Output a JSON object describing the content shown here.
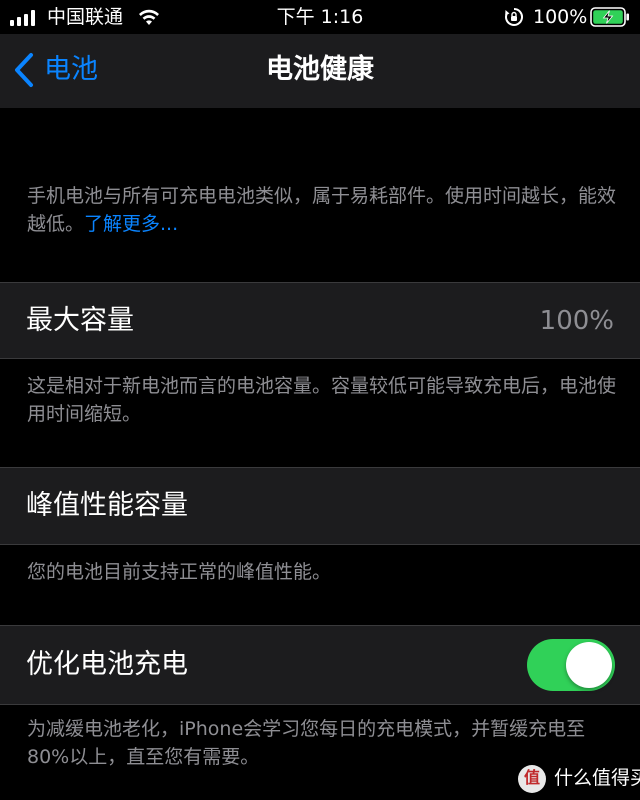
{
  "status_bar": {
    "carrier": "中国联通",
    "time": "下午 1:16",
    "battery_percent": "100%",
    "icons": [
      "signal-icon",
      "wifi-icon",
      "orientation-lock-icon",
      "battery-charging-icon"
    ]
  },
  "nav": {
    "back_label": "电池",
    "title": "电池健康"
  },
  "intro": {
    "text": "手机电池与所有可充电电池类似，属于易耗部件。使用时间越长，能效越低。",
    "link": "了解更多..."
  },
  "max_capacity": {
    "label": "最大容量",
    "value": "100%",
    "footer": "这是相对于新电池而言的电池容量。容量较低可能导致充电后，电池使用时间缩短。"
  },
  "peak_performance": {
    "label": "峰值性能容量",
    "footer": "您的电池目前支持正常的峰值性能。"
  },
  "optimized_charging": {
    "label": "优化电池充电",
    "enabled": true,
    "footer": "为减缓电池老化，iPhone会学习您每日的充电模式，并暂缓充电至80%以上，直至您有需要。"
  },
  "watermark": {
    "logo_text": "值",
    "text": "什么值得买"
  },
  "colors": {
    "accent": "#0a84ff",
    "toggle_on": "#30d158",
    "cell_bg": "#1c1c1e",
    "secondary_text": "#8e8e93",
    "background": "#000000"
  }
}
